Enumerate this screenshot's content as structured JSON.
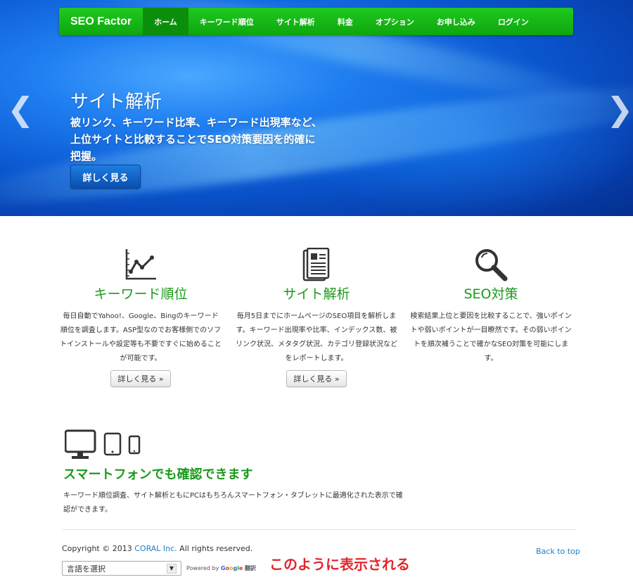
{
  "nav": {
    "brand": "SEO Factor",
    "items": [
      {
        "label": "ホーム",
        "active": true
      },
      {
        "label": "キーワード順位"
      },
      {
        "label": "サイト解析"
      },
      {
        "label": "料金"
      },
      {
        "label": "オプション"
      },
      {
        "label": "お申し込み"
      },
      {
        "label": "ログイン"
      }
    ]
  },
  "hero": {
    "title": "サイト解析",
    "description": "被リンク、キーワード比率、キーワード出現率など、上位サイトと比較することでSEO対策要因を的確に把握。",
    "button": "詳しく見る",
    "prev": "❮",
    "next": "❯"
  },
  "features": [
    {
      "icon": "chart-line-icon",
      "title": "キーワード順位",
      "text": "毎日自動でYahoo!、Google、Bingのキーワード順位を調査します。ASP型なのでお客様側でのソフトインストールや設定等も不要ですぐに始めることが可能です。",
      "button": "詳しく見る »"
    },
    {
      "icon": "document-icon",
      "title": "サイト解析",
      "text": "毎月5日までにホームページのSEO項目を解析します。キーワード出現率や比率、インデックス数、被リンク状況、メタタグ状況、カテゴリ登録状況などをレポートします。",
      "button": "詳しく見る »"
    },
    {
      "icon": "magnifier-icon",
      "title": "SEO対策",
      "text": "検索結果上位と要因を比較することで、強いポイントや弱いポイントが一目瞭然です。その弱いポイントを順次補うことで確かなSEO対策を可能にします。"
    }
  ],
  "smartphone": {
    "title": "スマートフォンでも確認できます",
    "text": "キーワード順位調査、サイト解析ともにPCはもちろんスマートフォン・タブレットに最適化された表示で確認ができます。"
  },
  "footer": {
    "copyright_prefix": "Copyright © 2013 ",
    "company": "CORAL Inc.",
    "copyright_suffix": " All rights reserved.",
    "back_to_top": "Back to top",
    "language_select": "言語を選択",
    "powered_by": "Powered by ",
    "google": [
      "G",
      "o",
      "o",
      "g",
      "l",
      "e"
    ],
    "translate": "翻訳"
  },
  "annotation": "このように表示される",
  "colors": {
    "nav_green": "#0ea60e",
    "title_green": "#1a9a1a",
    "link_blue": "#1a7fc9",
    "annotation_red": "#e3262b"
  }
}
